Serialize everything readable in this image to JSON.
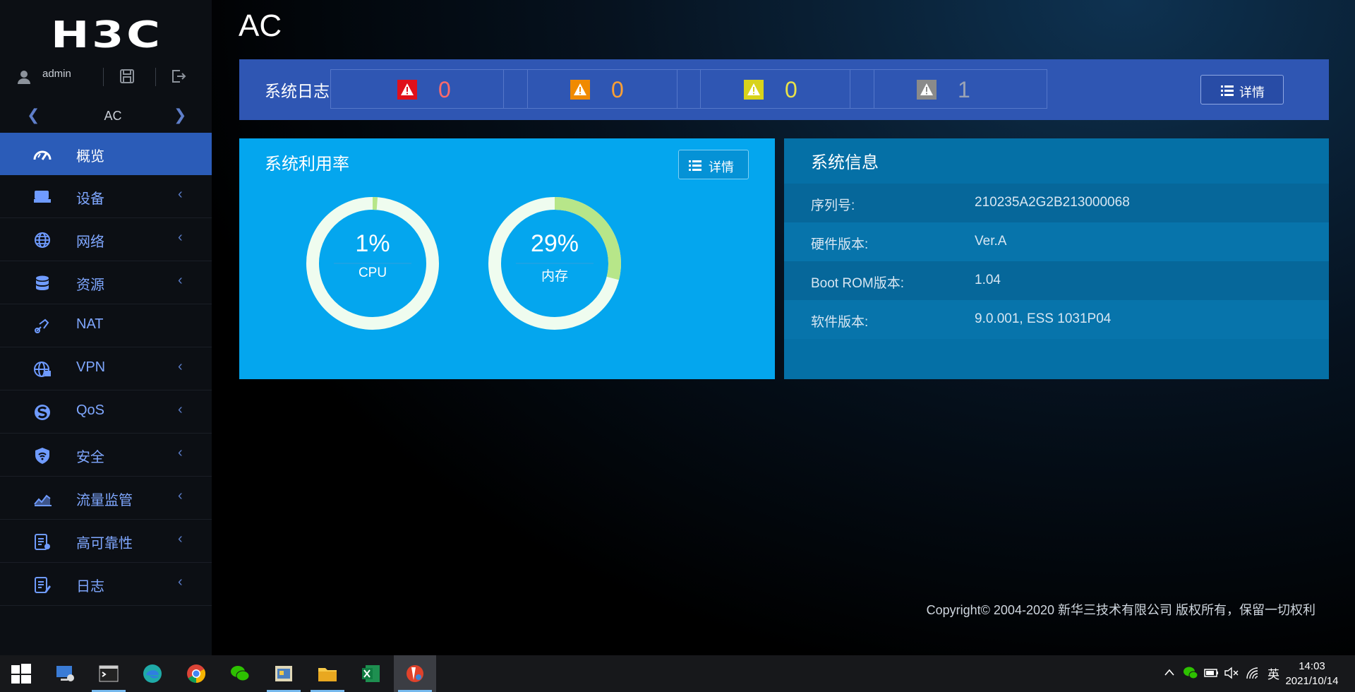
{
  "brand": {
    "logo": "H3C"
  },
  "user": {
    "name": "admin"
  },
  "device": {
    "name": "AC"
  },
  "nav": [
    {
      "label": "概览",
      "icon": "gauge-icon",
      "active": true,
      "expandable": false
    },
    {
      "label": "设备",
      "icon": "device-icon",
      "expandable": true
    },
    {
      "label": "网络",
      "icon": "globe-icon",
      "expandable": true
    },
    {
      "label": "资源",
      "icon": "database-icon",
      "expandable": true
    },
    {
      "label": "NAT",
      "icon": "nat-link-icon",
      "expandable": false
    },
    {
      "label": "VPN",
      "icon": "vpn-globe-icon",
      "expandable": true
    },
    {
      "label": "QoS",
      "icon": "qos-icon",
      "expandable": true
    },
    {
      "label": "安全",
      "icon": "shield-icon",
      "expandable": true
    },
    {
      "label": "流量监管",
      "icon": "traffic-chart-icon",
      "expandable": true
    },
    {
      "label": "高可靠性",
      "icon": "reliability-icon",
      "expandable": true
    },
    {
      "label": "日志",
      "icon": "log-icon",
      "expandable": true
    }
  ],
  "page": {
    "title": "AC"
  },
  "syslog": {
    "title": "系统日志",
    "levels": [
      {
        "color": "#e0101a",
        "count": "0",
        "count_color": "#ff6a6a"
      },
      {
        "color": "#f08a00",
        "count": "0",
        "count_color": "#ffa033"
      },
      {
        "color": "#d8d31a",
        "count": "0",
        "count_color": "#e8e24a"
      },
      {
        "color": "#8a8a8a",
        "count": "1",
        "count_color": "#9aa3b5"
      }
    ],
    "detail_label": "详情"
  },
  "utilization": {
    "title": "系统利用率",
    "detail_label": "详情",
    "gauges": [
      {
        "value_label": "1%",
        "label": "CPU",
        "fraction": 0.01
      },
      {
        "value_label": "29%",
        "label": "内存",
        "fraction": 0.29
      }
    ]
  },
  "sysinfo": {
    "title": "系统信息",
    "rows": [
      {
        "key": "序列号:",
        "value": "210235A2G2B213000068"
      },
      {
        "key": "硬件版本:",
        "value": "Ver.A"
      },
      {
        "key": "Boot ROM版本:",
        "value": "1.04"
      },
      {
        "key": "软件版本:",
        "value": "9.0.001, ESS 1031P04"
      }
    ]
  },
  "footer": {
    "copyright": "Copyright© 2004-2020 新华三技术有限公司 版权所有，保留一切权利"
  },
  "taskbar": {
    "apps": [
      "start-icon",
      "remote-desktop-icon",
      "terminal-icon",
      "edge-icon",
      "chrome-icon",
      "wechat-icon",
      "control-panel-icon",
      "file-explorer-icon",
      "excel-icon",
      "browser-app-icon"
    ],
    "ime": "英",
    "time": "14:03",
    "date": "2021/10/14"
  }
}
